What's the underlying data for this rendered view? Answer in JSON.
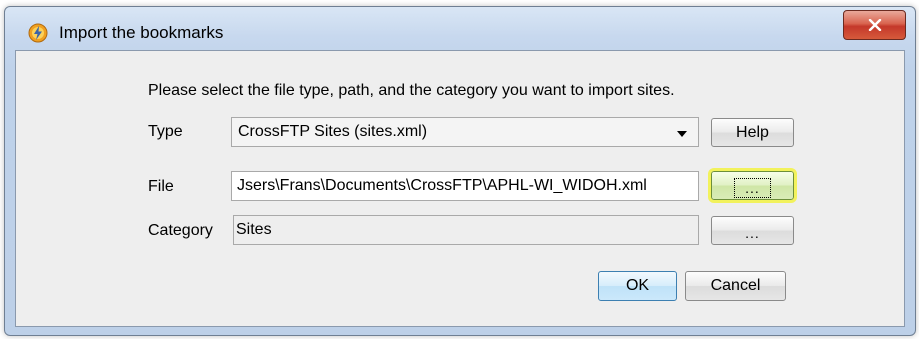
{
  "window": {
    "title": "Import the bookmarks",
    "close_label": "x"
  },
  "dialog": {
    "instruction": "Please select the file type, path, and the category you want to import sites.",
    "type": {
      "label": "Type",
      "selected": "CrossFTP Sites (sites.xml)",
      "help_label": "Help"
    },
    "file": {
      "label": "File",
      "value": "Jsers\\Frans\\Documents\\CrossFTP\\APHL-WI_WIDOH.xml",
      "browse_label": "..."
    },
    "category": {
      "label": "Category",
      "value": "Sites",
      "browse_label": "..."
    },
    "ok_label": "OK",
    "cancel_label": "Cancel"
  },
  "colors": {
    "title_bar": "#c7d8ee",
    "close_button": "#c4382a",
    "focus_highlight": "#f2f25c",
    "default_button": "#3c7fb1"
  },
  "icons": {
    "app": "crossftp-lightning-icon",
    "dropdown": "chevron-down-icon",
    "close": "close-icon"
  }
}
